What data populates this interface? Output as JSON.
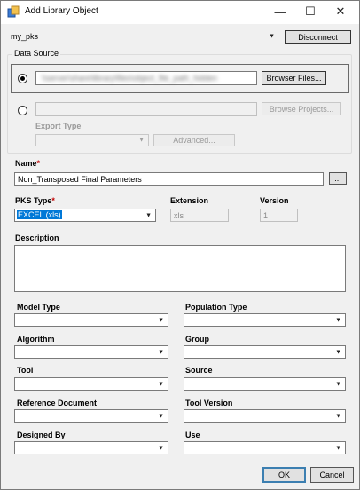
{
  "window": {
    "title": "Add Library Object",
    "minimize_glyph": "—",
    "maximize_glyph": "☐",
    "close_glyph": "✕"
  },
  "connection": {
    "selected": "my_pks",
    "disconnect_label": "Disconnect"
  },
  "data_source": {
    "legend": "Data Source",
    "file_path": "\\\\server\\share\\library\\files\\object_file_path_hidden",
    "browse_files_label": "Browser Files...",
    "project_path": "",
    "browse_projects_label": "Browse Projects...",
    "export_type_label": "Export Type",
    "export_type_value": "",
    "advanced_label": "Advanced..."
  },
  "name": {
    "label": "Name",
    "required_mark": "*",
    "value": "Non_Transposed Final Parameters",
    "ellipsis_label": "..."
  },
  "pks_type": {
    "label": "PKS Type",
    "required_mark": "*",
    "value": "EXCEL (xls)"
  },
  "extension": {
    "label": "Extension",
    "value": "xls"
  },
  "version": {
    "label": "Version",
    "value": "1"
  },
  "description": {
    "label": "Description",
    "value": ""
  },
  "dropdowns": {
    "model_type": {
      "label": "Model Type",
      "value": ""
    },
    "population_type": {
      "label": "Population Type",
      "value": ""
    },
    "algorithm": {
      "label": "Algorithm",
      "value": ""
    },
    "group": {
      "label": "Group",
      "value": ""
    },
    "tool": {
      "label": "Tool",
      "value": ""
    },
    "source": {
      "label": "Source",
      "value": ""
    },
    "reference_document": {
      "label": "Reference Document",
      "value": ""
    },
    "tool_version": {
      "label": "Tool Version",
      "value": ""
    },
    "designed_by": {
      "label": "Designed By",
      "value": ""
    },
    "use": {
      "label": "Use",
      "value": ""
    }
  },
  "footer": {
    "ok_label": "OK",
    "cancel_label": "Cancel"
  },
  "icons": {
    "dropdown_arrow": "▼"
  },
  "colors": {
    "selection_highlight": "#0078d7",
    "required_asterisk": "#c00000"
  }
}
